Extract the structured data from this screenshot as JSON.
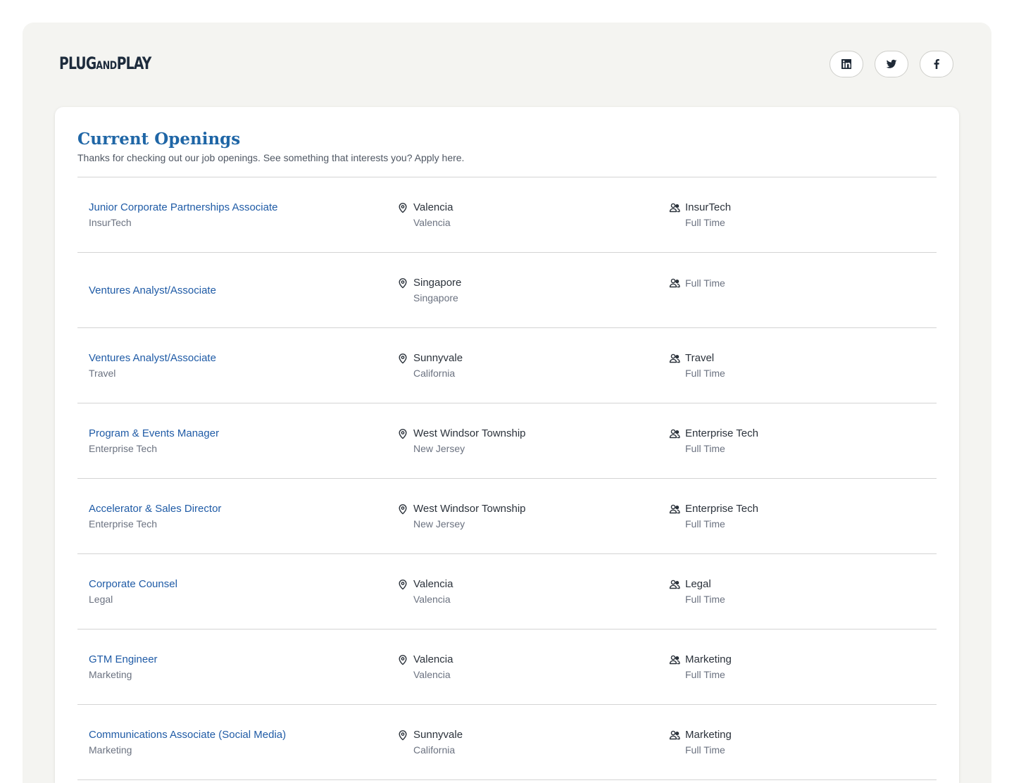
{
  "header": {
    "logo": {
      "part1": "PLUG",
      "part2": "AND",
      "part3": "PLAY"
    },
    "socials": [
      {
        "name": "linkedin",
        "icon": "linkedin-icon"
      },
      {
        "name": "twitter",
        "icon": "twitter-icon"
      },
      {
        "name": "facebook",
        "icon": "facebook-icon"
      }
    ]
  },
  "main": {
    "title": "Current Openings",
    "subtitle": "Thanks for checking out our job openings. See something that interests you? Apply here.",
    "jobs": [
      {
        "title": "Junior Corporate Partnerships Associate",
        "department_sub": "InsurTech",
        "city": "Valencia",
        "region": "Valencia",
        "department": "InsurTech",
        "employment": "Full Time"
      },
      {
        "title": "Ventures Analyst/Associate",
        "department_sub": "",
        "city": "Singapore",
        "region": "Singapore",
        "department": "",
        "employment": "Full Time"
      },
      {
        "title": "Ventures Analyst/Associate",
        "department_sub": "Travel",
        "city": "Sunnyvale",
        "region": "California",
        "department": "Travel",
        "employment": "Full Time"
      },
      {
        "title": "Program & Events Manager",
        "department_sub": "Enterprise Tech",
        "city": "West Windsor Township",
        "region": "New Jersey",
        "department": "Enterprise Tech",
        "employment": "Full Time"
      },
      {
        "title": "Accelerator & Sales Director",
        "department_sub": "Enterprise Tech",
        "city": "West Windsor Township",
        "region": "New Jersey",
        "department": "Enterprise Tech",
        "employment": "Full Time"
      },
      {
        "title": "Corporate Counsel",
        "department_sub": "Legal",
        "city": "Valencia",
        "region": "Valencia",
        "department": "Legal",
        "employment": "Full Time"
      },
      {
        "title": "GTM Engineer",
        "department_sub": "Marketing",
        "city": "Valencia",
        "region": "Valencia",
        "department": "Marketing",
        "employment": "Full Time"
      },
      {
        "title": "Communications Associate (Social Media)",
        "department_sub": "Marketing",
        "city": "Sunnyvale",
        "region": "California",
        "department": "Marketing",
        "employment": "Full Time"
      }
    ]
  }
}
